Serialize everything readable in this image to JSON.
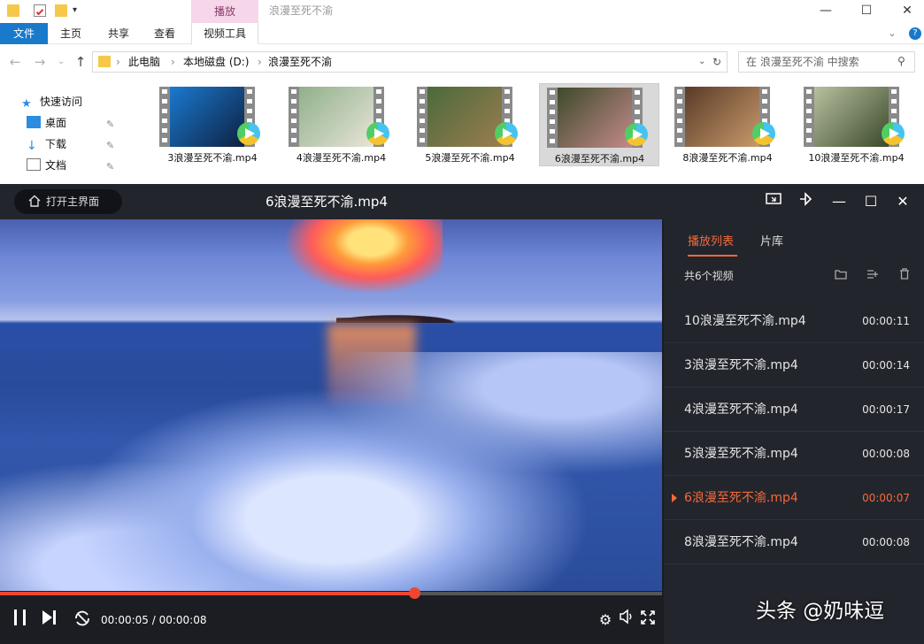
{
  "explorer": {
    "context_tab": "播放",
    "window_title": "浪漫至死不渝",
    "window_controls": {
      "minimize": "—",
      "maximize": "☐",
      "close": "✕"
    },
    "ribbon_tabs": [
      "文件",
      "主页",
      "共享",
      "查看",
      "视频工具"
    ],
    "address": {
      "crumbs": [
        "此电脑",
        "本地磁盘 (D:)",
        "浪漫至死不渝"
      ]
    },
    "search": {
      "placeholder": "在 浪漫至死不渝 中搜索"
    },
    "nav_pane": [
      {
        "label": "快速访问",
        "icon": "star-icon"
      },
      {
        "label": "桌面",
        "icon": "desktop-icon"
      },
      {
        "label": "下载",
        "icon": "download-icon"
      },
      {
        "label": "文档",
        "icon": "document-icon"
      }
    ],
    "files": [
      {
        "name": "3浪漫至死不渝.mp4",
        "selected": false,
        "colors": [
          "#1a7ad0",
          "#0e2040"
        ]
      },
      {
        "name": "4浪漫至死不渝.mp4",
        "selected": false,
        "colors": [
          "#8fb08a",
          "#e8e4d8"
        ]
      },
      {
        "name": "5浪漫至死不渝.mp4",
        "selected": false,
        "colors": [
          "#4b6a3a",
          "#9a7d50"
        ]
      },
      {
        "name": "6浪漫至死不渝.mp4",
        "selected": true,
        "colors": [
          "#3d4a2a",
          "#c48a8a"
        ]
      },
      {
        "name": "8浪漫至死不渝.mp4",
        "selected": false,
        "colors": [
          "#5a3a28",
          "#c89a6a"
        ]
      },
      {
        "name": "10浪漫至死不渝.mp4",
        "selected": false,
        "colors": [
          "#b8c0a0",
          "#3a4a2a"
        ]
      }
    ]
  },
  "player": {
    "home_label": "打开主界面",
    "title": "6浪漫至死不渝.mp4",
    "time_current": "00:00:05",
    "time_total": "00:00:08",
    "time_separator": " / ",
    "progress_fraction": 0.625,
    "accent_color": "#f0462e",
    "sidebar": {
      "tabs": [
        "播放列表",
        "片库"
      ],
      "count_label": "共6个视频",
      "playlist": [
        {
          "name": "10浪漫至死不渝.mp4",
          "duration": "00:00:11",
          "active": false
        },
        {
          "name": "3浪漫至死不渝.mp4",
          "duration": "00:00:14",
          "active": false
        },
        {
          "name": "4浪漫至死不渝.mp4",
          "duration": "00:00:17",
          "active": false
        },
        {
          "name": "5浪漫至死不渝.mp4",
          "duration": "00:00:08",
          "active": false
        },
        {
          "name": "6浪漫至死不渝.mp4",
          "duration": "00:00:07",
          "active": true
        },
        {
          "name": "8浪漫至死不渝.mp4",
          "duration": "00:00:08",
          "active": false
        }
      ]
    }
  },
  "watermark": "头条 @奶味逗"
}
